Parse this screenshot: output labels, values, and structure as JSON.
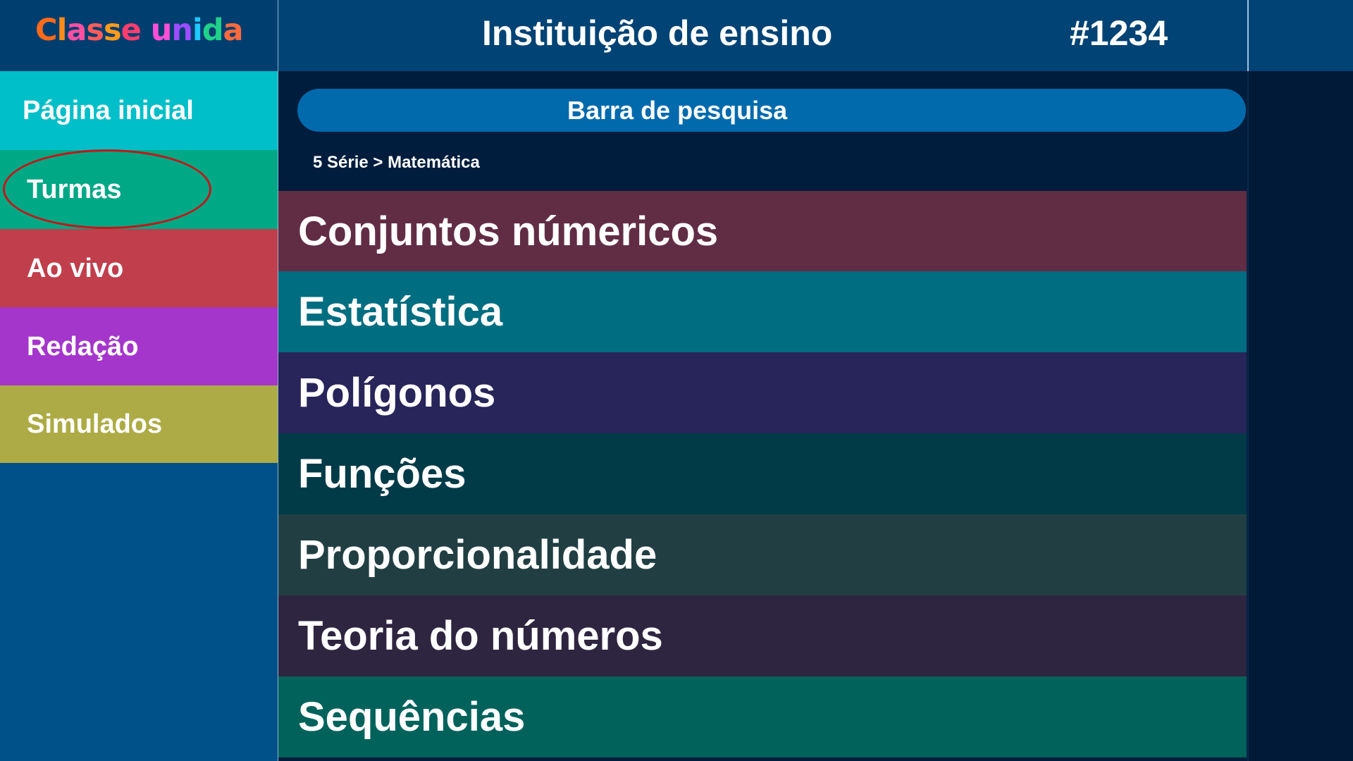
{
  "logo": {
    "text": "Classe unida",
    "letters": [
      {
        "ch": "C",
        "color": "#ff6a1a"
      },
      {
        "ch": "l",
        "color": "#ff8c1a"
      },
      {
        "ch": "a",
        "color": "#ff4fa0"
      },
      {
        "ch": "s",
        "color": "#ff5c5c"
      },
      {
        "ch": "s",
        "color": "#ff9a1a"
      },
      {
        "ch": "e",
        "color": "#ff3d6e"
      },
      {
        "ch": " ",
        "color": "#ffffff"
      },
      {
        "ch": "u",
        "color": "#ff4fd8"
      },
      {
        "ch": "n",
        "color": "#9b4dff"
      },
      {
        "ch": "i",
        "color": "#1ec8ff"
      },
      {
        "ch": "d",
        "color": "#20d08a"
      },
      {
        "ch": "a",
        "color": "#ff6a3d"
      }
    ]
  },
  "header": {
    "title": "Instituição de ensino",
    "id": "#1234"
  },
  "sidebar": {
    "items": [
      {
        "label": "Página inicial",
        "color": "#00bfc8"
      },
      {
        "label": "Turmas",
        "color": "#00a886",
        "highlighted": true
      },
      {
        "label": "Ao vivo",
        "color": "#c13e4c"
      },
      {
        "label": "Redação",
        "color": "#a536cc"
      },
      {
        "label": "Simulados",
        "color": "#adab45"
      }
    ]
  },
  "search": {
    "placeholder": "Barra de pesquisa"
  },
  "breadcrumb": "5 Série > Matemática",
  "topics": [
    {
      "label": "Conjuntos númericos",
      "color": "#612d45"
    },
    {
      "label": "Estatística",
      "color": "#016d80"
    },
    {
      "label": "Polígonos",
      "color": "#28255a"
    },
    {
      "label": "Funções",
      "color": "#023b48"
    },
    {
      "label": "Proporcionalidade",
      "color": "#213f42"
    },
    {
      "label": "Teoria do números",
      "color": "#2e2540"
    },
    {
      "label": "Sequências",
      "color": "#01625c"
    }
  ]
}
